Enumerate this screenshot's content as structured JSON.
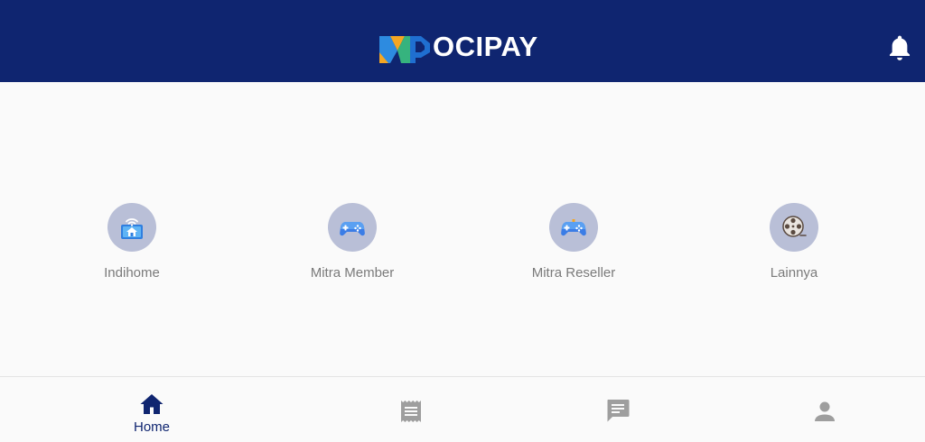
{
  "header": {
    "brand_name": "OCIPAY",
    "background_color": "#0f2570",
    "notification_icon": "bell-icon"
  },
  "menu": {
    "items": [
      {
        "label": "Indihome",
        "icon": "wifi-house-icon"
      },
      {
        "label": "Mitra Member",
        "icon": "gamepad-icon"
      },
      {
        "label": "Mitra Reseller",
        "icon": "gamepad-icon"
      },
      {
        "label": "Lainnya",
        "icon": "film-reel-icon"
      }
    ],
    "icon_background": "#b9bfd7"
  },
  "bottom_nav": {
    "items": [
      {
        "label": "Home",
        "icon": "home-icon",
        "active": true
      },
      {
        "label": "",
        "icon": "receipt-icon",
        "active": false
      },
      {
        "label": "",
        "icon": "chat-icon",
        "active": false
      },
      {
        "label": "",
        "icon": "person-icon",
        "active": false
      }
    ],
    "active_color": "#0f2570",
    "inactive_color": "#9e9e9e"
  }
}
